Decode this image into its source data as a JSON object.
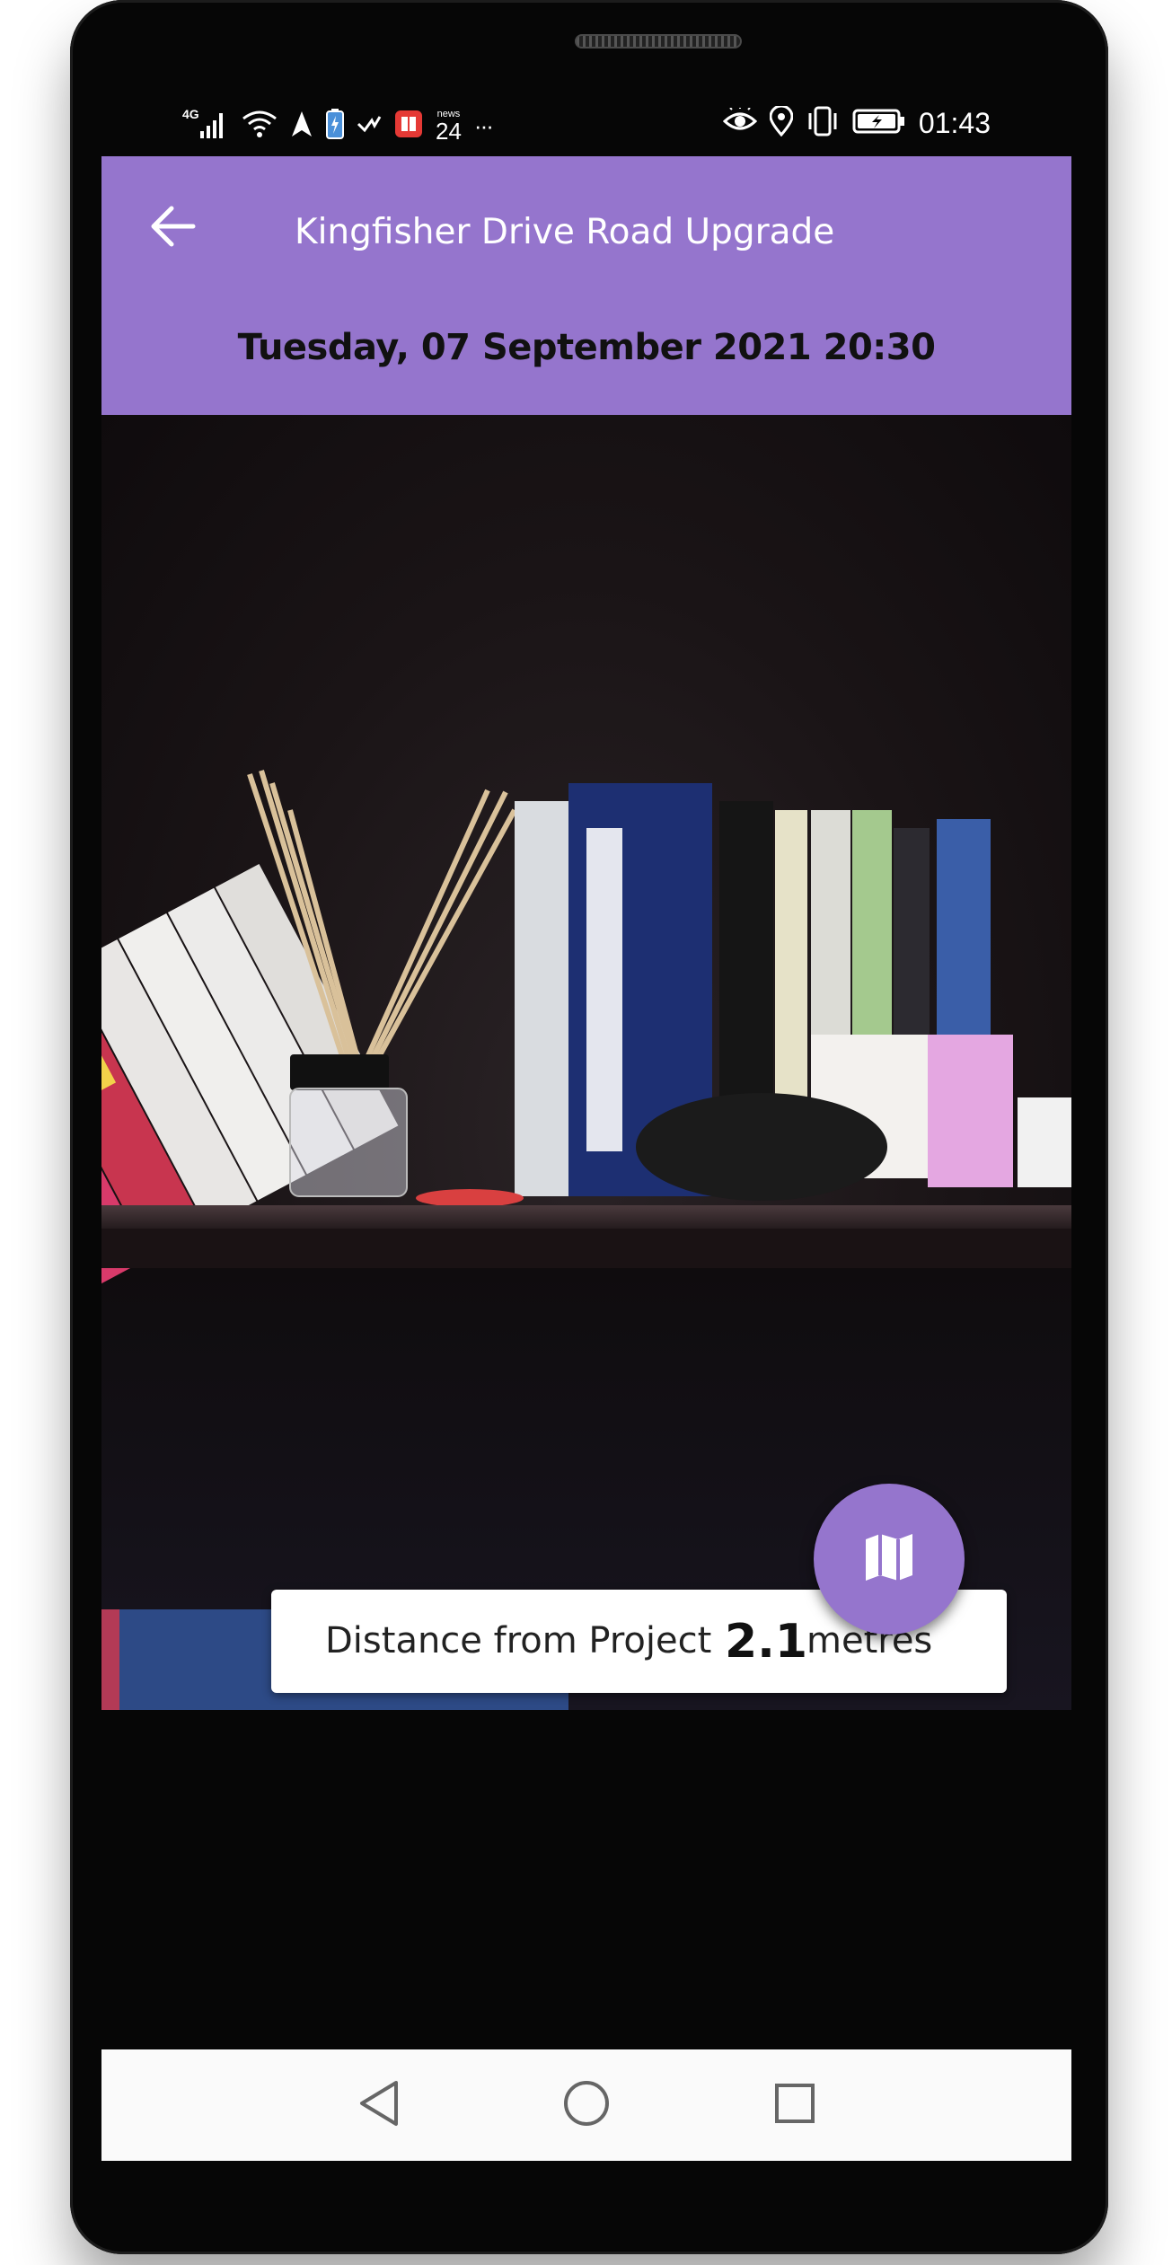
{
  "status_bar": {
    "network": "4G",
    "news_label": "news",
    "news_count": "24",
    "more": "···",
    "time": "01:43",
    "left_icons": [
      "signal-icon",
      "wifi-icon",
      "navigation-icon",
      "battery-saver-icon",
      "check-icon",
      "news-app-icon",
      "more-dots-icon"
    ],
    "right_icons": [
      "eye-icon",
      "location-icon",
      "vibrate-icon",
      "battery-charging-icon"
    ]
  },
  "app_bar": {
    "back_icon": "arrow-back-icon",
    "title": "Kingfisher Drive Road Upgrade",
    "datetime": "Tuesday, 07 September 2021 20:30",
    "background": "#9575cd"
  },
  "photo": {
    "description_icon": "photo"
  },
  "distance": {
    "label": "Distance from Project",
    "value": "2.1",
    "unit": "metres"
  },
  "fab": {
    "icon": "map-icon",
    "color": "#9575cd"
  },
  "nav_bar": {
    "icons": [
      "nav-back-icon",
      "nav-home-icon",
      "nav-recents-icon"
    ]
  }
}
